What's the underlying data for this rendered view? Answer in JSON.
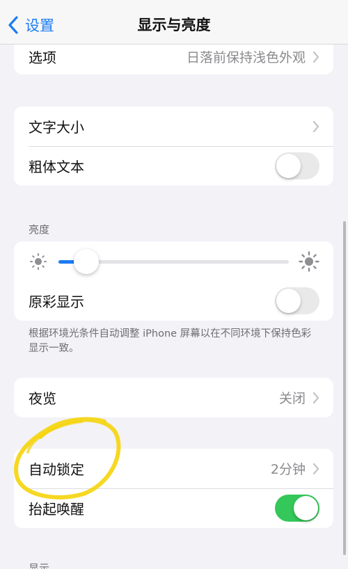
{
  "colors": {
    "accent": "#1c7cf4",
    "toggle_on": "#34c759",
    "annotation": "#f5d40a"
  },
  "header": {
    "back_label": "设置",
    "title": "显示与亮度"
  },
  "appearance": {
    "options_label": "选项",
    "options_value": "日落前保持浅色外观"
  },
  "text": {
    "text_size_label": "文字大小",
    "bold_text_label": "粗体文本",
    "bold_text_on": false
  },
  "brightness": {
    "section_header": "亮度",
    "level": 0.12,
    "true_tone_label": "原彩显示",
    "true_tone_on": false,
    "footnote": "根据环境光条件自动调整 iPhone 屏幕以在不同环境下保持色彩显示一致。"
  },
  "night_shift": {
    "label": "夜览",
    "value": "关闭"
  },
  "lock": {
    "auto_lock_label": "自动锁定",
    "auto_lock_value": "2分钟",
    "raise_to_wake_label": "抬起唤醒",
    "raise_to_wake_on": true
  },
  "next_section_header": "显示"
}
